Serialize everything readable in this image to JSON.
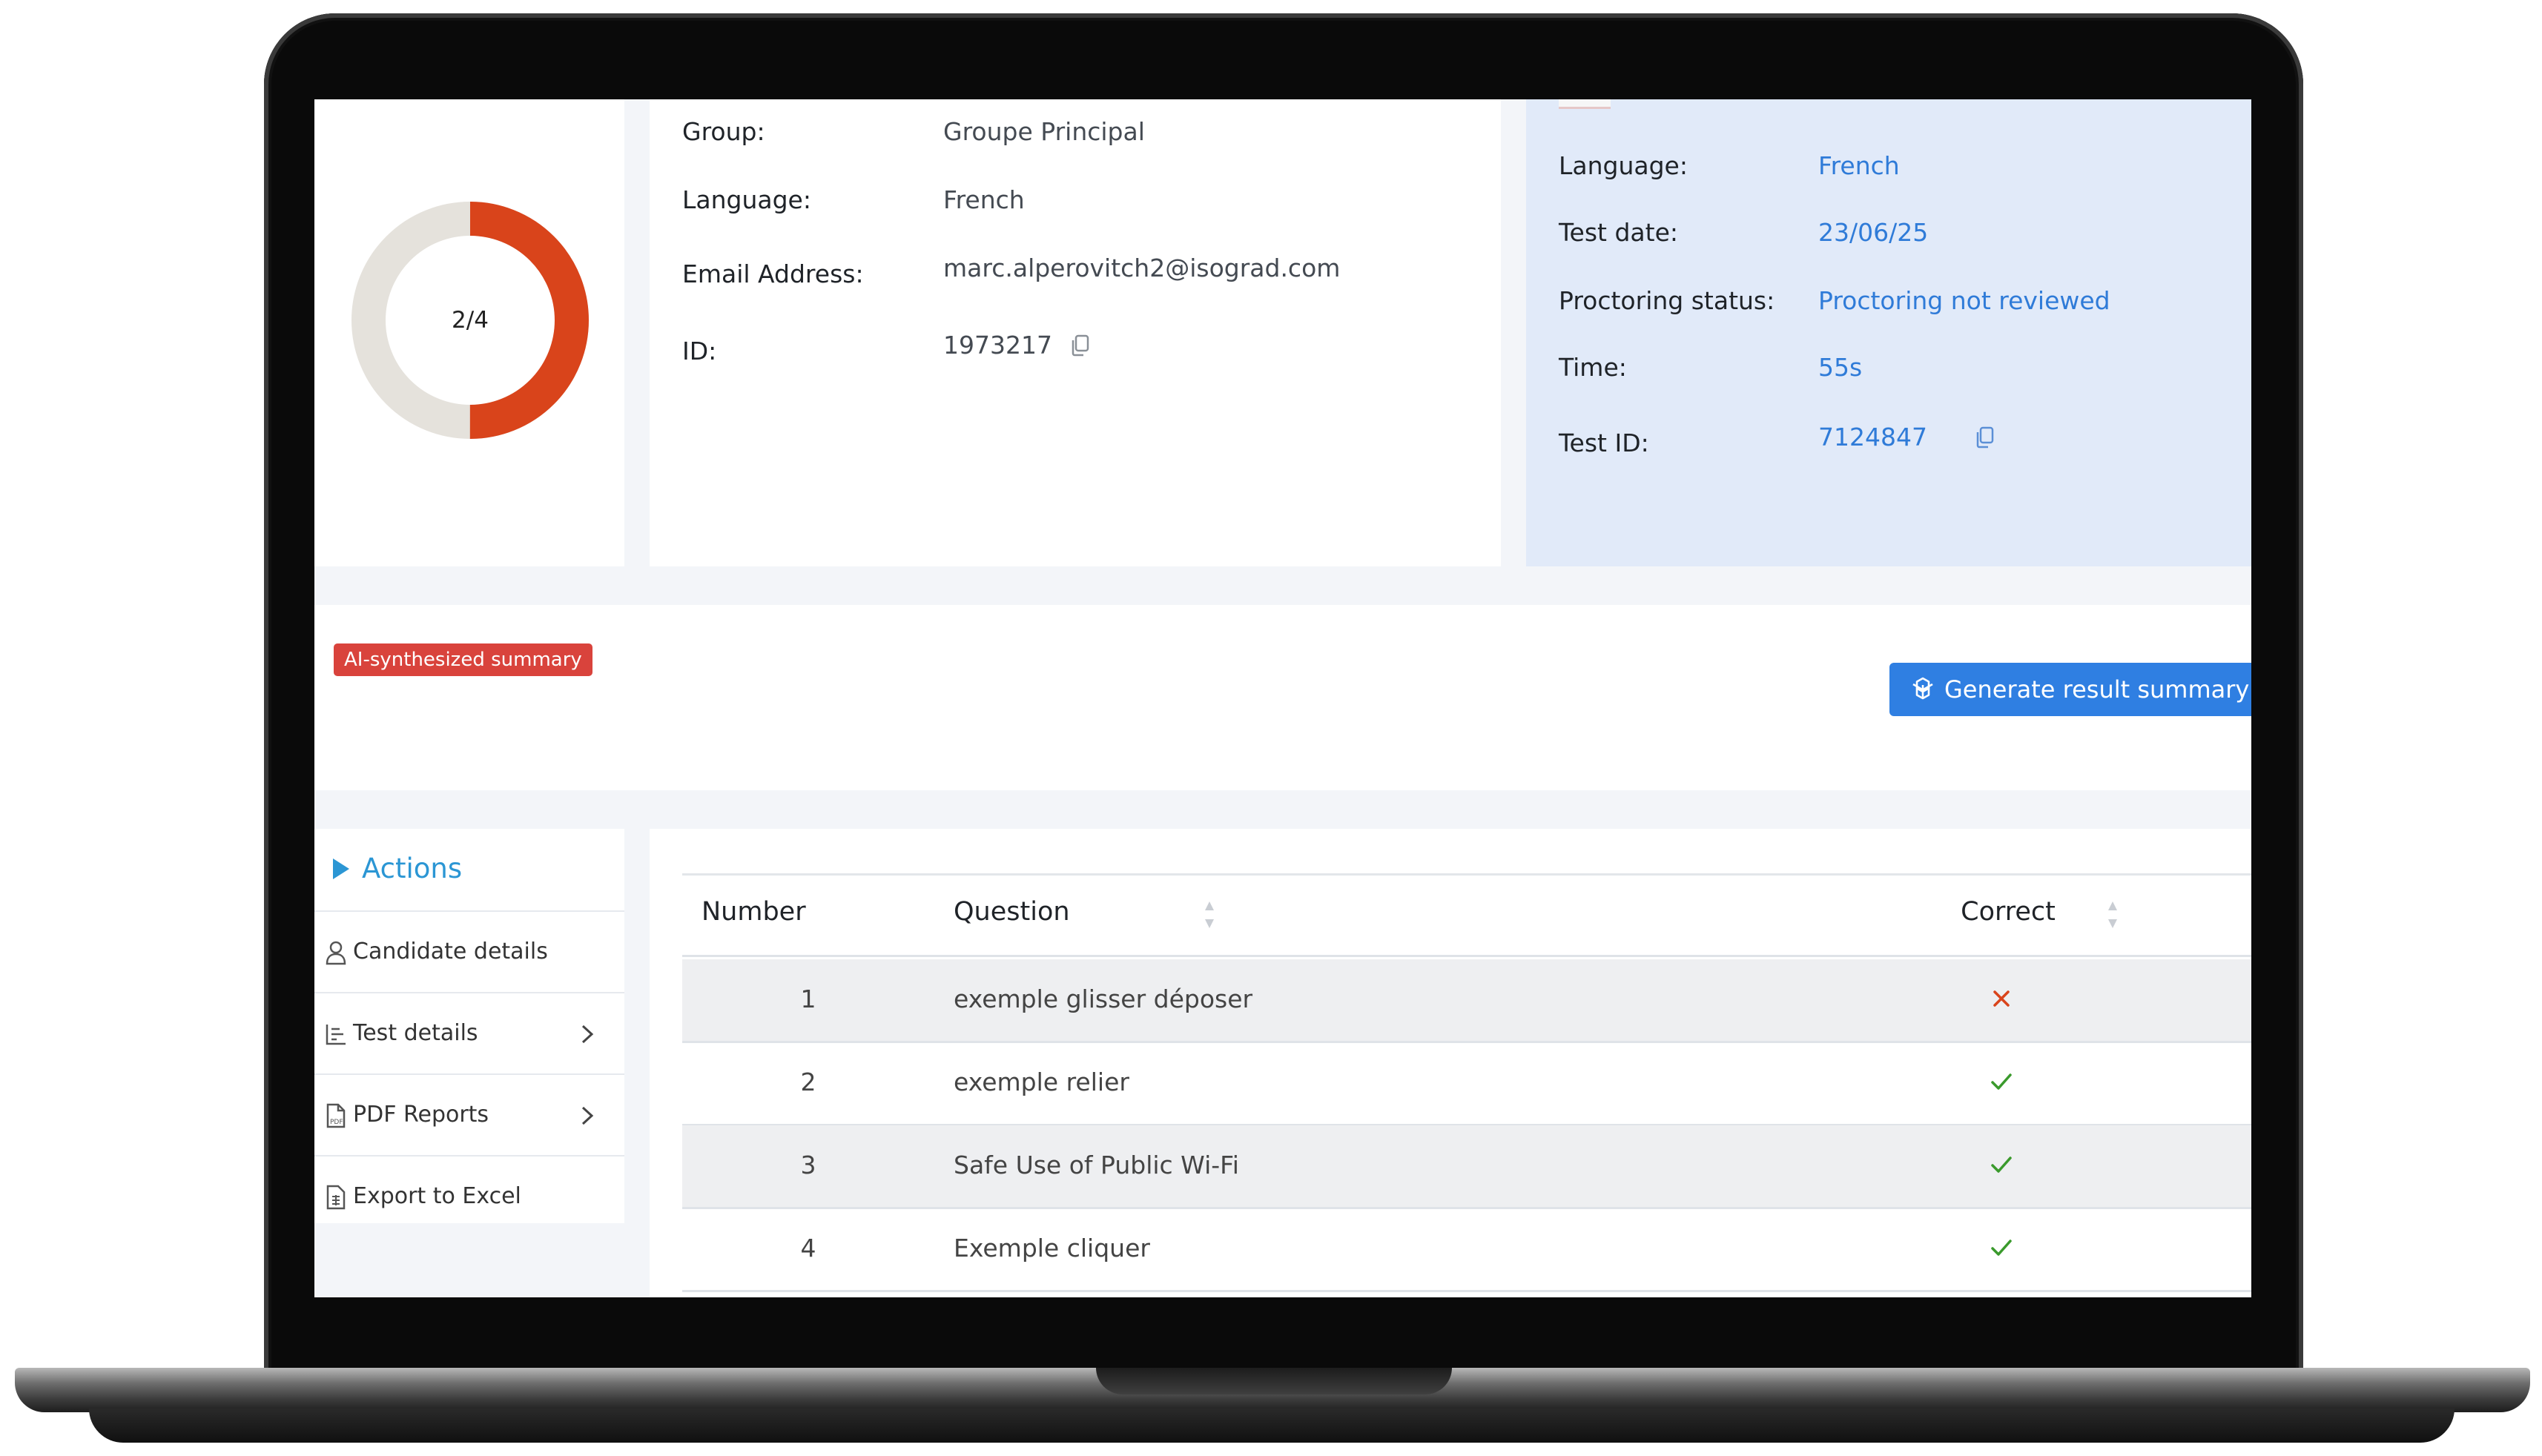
{
  "score": {
    "text": "2/4",
    "correct": 2,
    "total": 4,
    "ring_color": "#d9441b",
    "track_color": "#e5e2dc"
  },
  "candidate": {
    "group_label": "Group:",
    "group_value": "Groupe Principal",
    "language_label": "Language:",
    "language_value": "French",
    "email_label": "Email Address:",
    "email_value": "marc.alperovitch2@isograd.com",
    "id_label": "ID:",
    "id_value": "1973217"
  },
  "test": {
    "language_label": "Language:",
    "language_value": "French",
    "date_label": "Test date:",
    "date_value": "23/06/25",
    "proctoring_label": "Proctoring status:",
    "proctoring_value": "Proctoring not reviewed",
    "time_label": "Time:",
    "time_value": "55s",
    "test_id_label": "Test ID:",
    "test_id_value": "7124847"
  },
  "summary": {
    "badge": "AI-synthesized summary",
    "generate_button": "Generate result summary w"
  },
  "actions": {
    "title": "Actions",
    "items": [
      {
        "label": "Candidate details",
        "icon": "user-icon"
      },
      {
        "label": "Test details",
        "icon": "chart-icon"
      },
      {
        "label": "PDF Reports",
        "icon": "pdf-icon"
      },
      {
        "label": "Export to Excel",
        "icon": "excel-icon"
      }
    ]
  },
  "table": {
    "headers": {
      "number": "Number",
      "question": "Question",
      "correct": "Correct"
    },
    "rows": [
      {
        "number": "1",
        "question": "exemple glisser déposer",
        "correct": false
      },
      {
        "number": "2",
        "question": "exemple relier",
        "correct": true
      },
      {
        "number": "3",
        "question": "Safe Use of Public Wi-Fi",
        "correct": true
      },
      {
        "number": "4",
        "question": "Exemple cliquer",
        "correct": true
      }
    ]
  },
  "colors": {
    "accent": "#2f7fe2",
    "link_blue": "#2f7bd8",
    "test_panel_bg": "#e1eaf9",
    "badge_red": "#d9433c",
    "cross_red": "#d9441b",
    "check_green": "#3a9a2c",
    "actions_title": "#2b96d4"
  }
}
